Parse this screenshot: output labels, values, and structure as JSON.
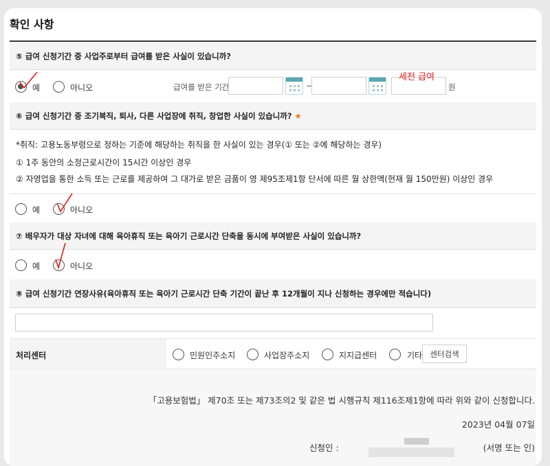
{
  "title": "확인 사항",
  "q5": {
    "question": "⑤ 급여 신청기간 중 사업주로부터 급여를 받은 사실이 있습니까?",
    "yes": "예",
    "no": "아니오",
    "period_label": "급여를 받은 기간",
    "tilde": "~",
    "annotation": "세전 급여",
    "unit": "원",
    "selected": "yes"
  },
  "q6": {
    "question": "⑥ 급여 신청기간 중 조기복직, 퇴사, 다른 사업장에 취직, 창업한 사실이 있습니까?",
    "required_mark": "★",
    "note1": "*취직: 고용노동부령으로 정하는 기준에 해당하는 취직을 한 사실이 있는 경우(① 또는 ②에 해당하는 경우)",
    "note2": "① 1주 동안의 소정근로시간이 15시간 이상인 경우",
    "note3": "② 자영업을 통한 소득 또는 근로를 제공하여 그 대가로 받은 금품이 영 제95조제1항 단서에 따른 월 상한액(현재 월 150만원) 이상인 경우",
    "yes": "예",
    "no": "아니오",
    "selected": "no"
  },
  "q7": {
    "question": "⑦ 배우자가 대상 자녀에 대해 육아휴직 또는 육아기 근로시간 단축을 동시에 부여받은 사실이 있습니까?",
    "yes": "예",
    "no": "아니오",
    "selected": "no"
  },
  "q8": {
    "question": "⑧ 급여 신청기간 연장사유(육아휴직 또는 육아기 근로시간 단축 기간이 끝난 후 12개월이 지나 신청하는 경우에만 적습니다)",
    "value": ""
  },
  "center": {
    "label": "처리센터",
    "options": [
      "민원인주소지",
      "사업장주소지",
      "지지급센터",
      "기타"
    ],
    "search_button": "센터검색"
  },
  "footer": {
    "statement": "「고용보험법」 제70조 또는 제73조의2 및 같은 법 시행규칙 제116조제1항에 따라 위와 같이 신청합니다.",
    "date": "2023년 04월 07일",
    "applicant_label": "신청인 :",
    "sign_note": "(서명 또는 인)"
  },
  "colors": {
    "question_bg": "#f4f4f4",
    "annotation_red": "#e02020",
    "calendar_accent": "#5aa6b4",
    "required_star": "#e07b1c"
  }
}
